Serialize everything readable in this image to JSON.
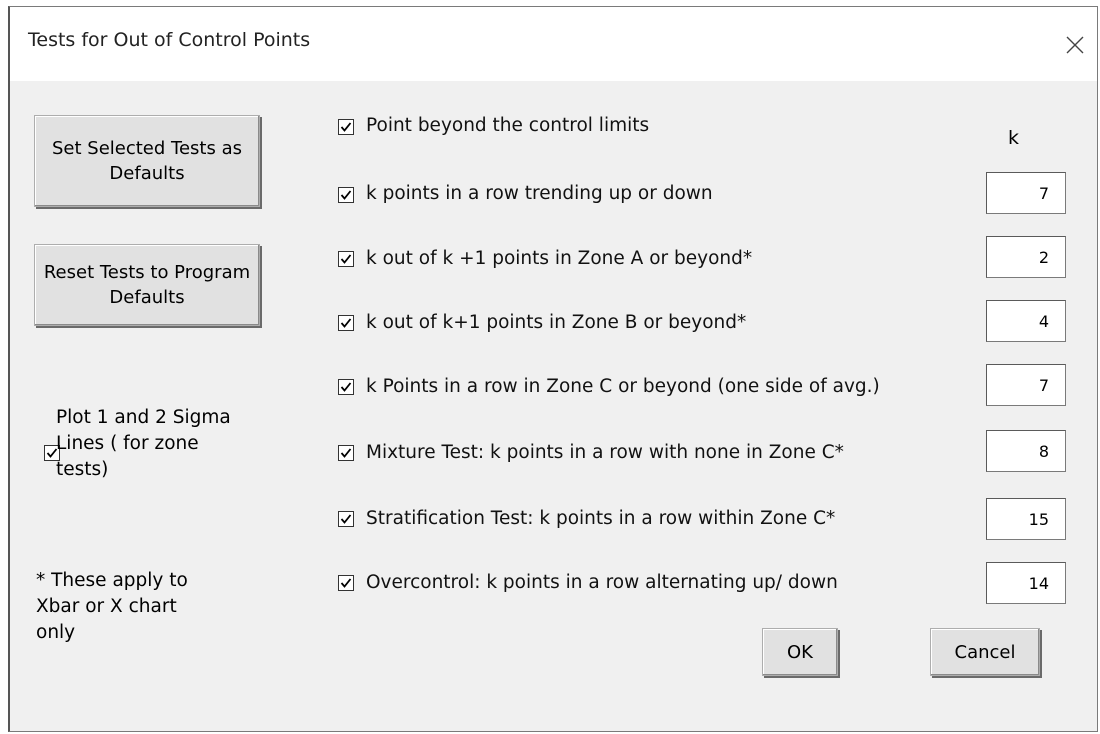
{
  "window": {
    "title": "Tests for Out of Control Points"
  },
  "buttons": {
    "set_defaults": "Set Selected Tests as Defaults",
    "reset_defaults": "Reset Tests to Program Defaults",
    "ok": "OK",
    "cancel": "Cancel"
  },
  "k_header": "k",
  "sigma_option": {
    "label": "Plot 1 and 2 Sigma Lines ( for zone tests)",
    "checked": true
  },
  "note": "* These apply to Xbar or X chart only",
  "tests": [
    {
      "label": "Point beyond the control limits",
      "checked": true,
      "k": null
    },
    {
      "label": "k points in a row trending up or down",
      "checked": true,
      "k": "7"
    },
    {
      "label": "k out  of k +1 points in Zone A or beyond*",
      "checked": true,
      "k": "2"
    },
    {
      "label": "k out of k+1 points in Zone B or beyond*",
      "checked": true,
      "k": "4"
    },
    {
      "label": "k Points in a row in Zone C or beyond (one side of avg.)",
      "checked": true,
      "k": "7"
    },
    {
      "label": "Mixture Test: k points in a row with none in Zone C*",
      "checked": true,
      "k": "8"
    },
    {
      "label": "Stratification Test: k points in a row within Zone C*",
      "checked": true,
      "k": "15"
    },
    {
      "label": "Overcontrol: k points in a row alternating up/ down",
      "checked": true,
      "k": "14"
    }
  ]
}
